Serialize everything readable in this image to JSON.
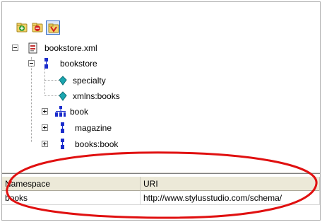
{
  "toolbar": {
    "buttons": [
      {
        "icon": "add-namespace-icon",
        "color": "#2e9b2e"
      },
      {
        "icon": "remove-namespace-icon",
        "color": "#d02020"
      },
      {
        "icon": "filter-namespace-icon",
        "color": "#d02020"
      }
    ]
  },
  "tree": {
    "root": {
      "label": "bookstore.xml",
      "icon": "xml-document-icon"
    },
    "bookstore": {
      "label": "bookstore",
      "icon": "element-icon"
    },
    "specialty": {
      "label": "specialty",
      "icon": "attribute-icon"
    },
    "xmlns_books": {
      "label": "xmlns:books",
      "icon": "attribute-icon"
    },
    "book": {
      "label": "book",
      "icon": "element-group-icon"
    },
    "magazine": {
      "label": "magazine",
      "icon": "element-icon"
    },
    "books_book": {
      "label": "books:book",
      "icon": "element-icon"
    }
  },
  "grid": {
    "columns": [
      "Namespace",
      "URI"
    ],
    "rows": [
      {
        "namespace": "books",
        "uri": "http://www.stylusstudio.com/schema/"
      }
    ]
  },
  "colors": {
    "highlight": "#e01010",
    "selection": "#316ac5",
    "element_icon": "#1a2ccc",
    "attribute_icon": "#1aa6b0"
  }
}
